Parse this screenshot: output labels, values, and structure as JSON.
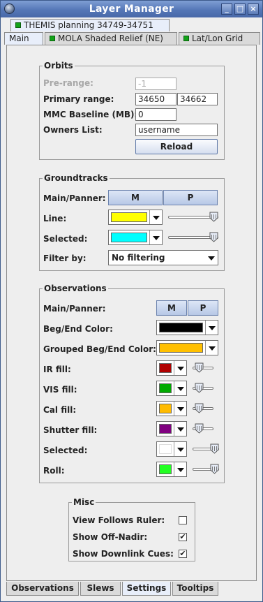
{
  "window": {
    "title": "Layer Manager",
    "buttons": {
      "minimize": "_",
      "maximize": "□",
      "close": "×"
    }
  },
  "top_tabs": {
    "row1": "THEMIS planning 34749-34751",
    "row2": [
      "Main",
      "MOLA Shaded Relief (NE)",
      "Lat/Lon Grid"
    ]
  },
  "orbits": {
    "legend": "Orbits",
    "pre_range_label": "Pre-range:",
    "pre_range_value": "-1",
    "primary_range_label": "Primary range:",
    "primary_start": "34650",
    "primary_end": "34662",
    "mmc_label": "MMC Baseline (MB):",
    "mmc_value": "0",
    "owners_label": "Owners List:",
    "owners_value": "username",
    "reload_label": "Reload"
  },
  "groundtracks": {
    "legend": "Groundtracks",
    "main_panner_label": "Main/Panner:",
    "m_label": "M",
    "p_label": "P",
    "line_label": "Line:",
    "line_color": "#ffff00",
    "line_opacity": 1.0,
    "selected_label": "Selected:",
    "selected_color": "#00ffff",
    "selected_opacity": 1.0,
    "filter_label": "Filter by:",
    "filter_value": "No filtering"
  },
  "observations": {
    "legend": "Observations",
    "main_panner_label": "Main/Panner:",
    "m_label": "M",
    "p_label": "P",
    "beg_end_label": "Beg/End Color:",
    "beg_end_color": "#000000",
    "grouped_label": "Grouped Beg/End Color:",
    "grouped_color": "#ffc000",
    "ir_label": "IR fill:",
    "ir_color": "#b00000",
    "ir_opacity": 0.2,
    "vis_label": "VIS fill:",
    "vis_color": "#00aa00",
    "vis_opacity": 0.2,
    "cal_label": "Cal fill:",
    "cal_color": "#ffbb00",
    "cal_opacity": 0.2,
    "shutter_label": "Shutter fill:",
    "shutter_color": "#800080",
    "shutter_opacity": 0.2,
    "selected_label": "Selected:",
    "selected_color": "#ffffff",
    "selected_opacity": 1.0,
    "roll_label": "Roll:",
    "roll_color": "#22ff22",
    "roll_opacity": 1.0
  },
  "misc": {
    "legend": "Misc",
    "view_follows_label": "View Follows Ruler:",
    "view_follows_checked": "",
    "off_nadir_label": "Show Off-Nadir:",
    "off_nadir_checked": "✔",
    "downlink_label": "Show Downlink Cues:",
    "downlink_checked": "✔"
  },
  "bottom_tabs": [
    "Observations",
    "Slews",
    "Settings",
    "Tooltips"
  ],
  "active_bottom_tab": "Settings"
}
